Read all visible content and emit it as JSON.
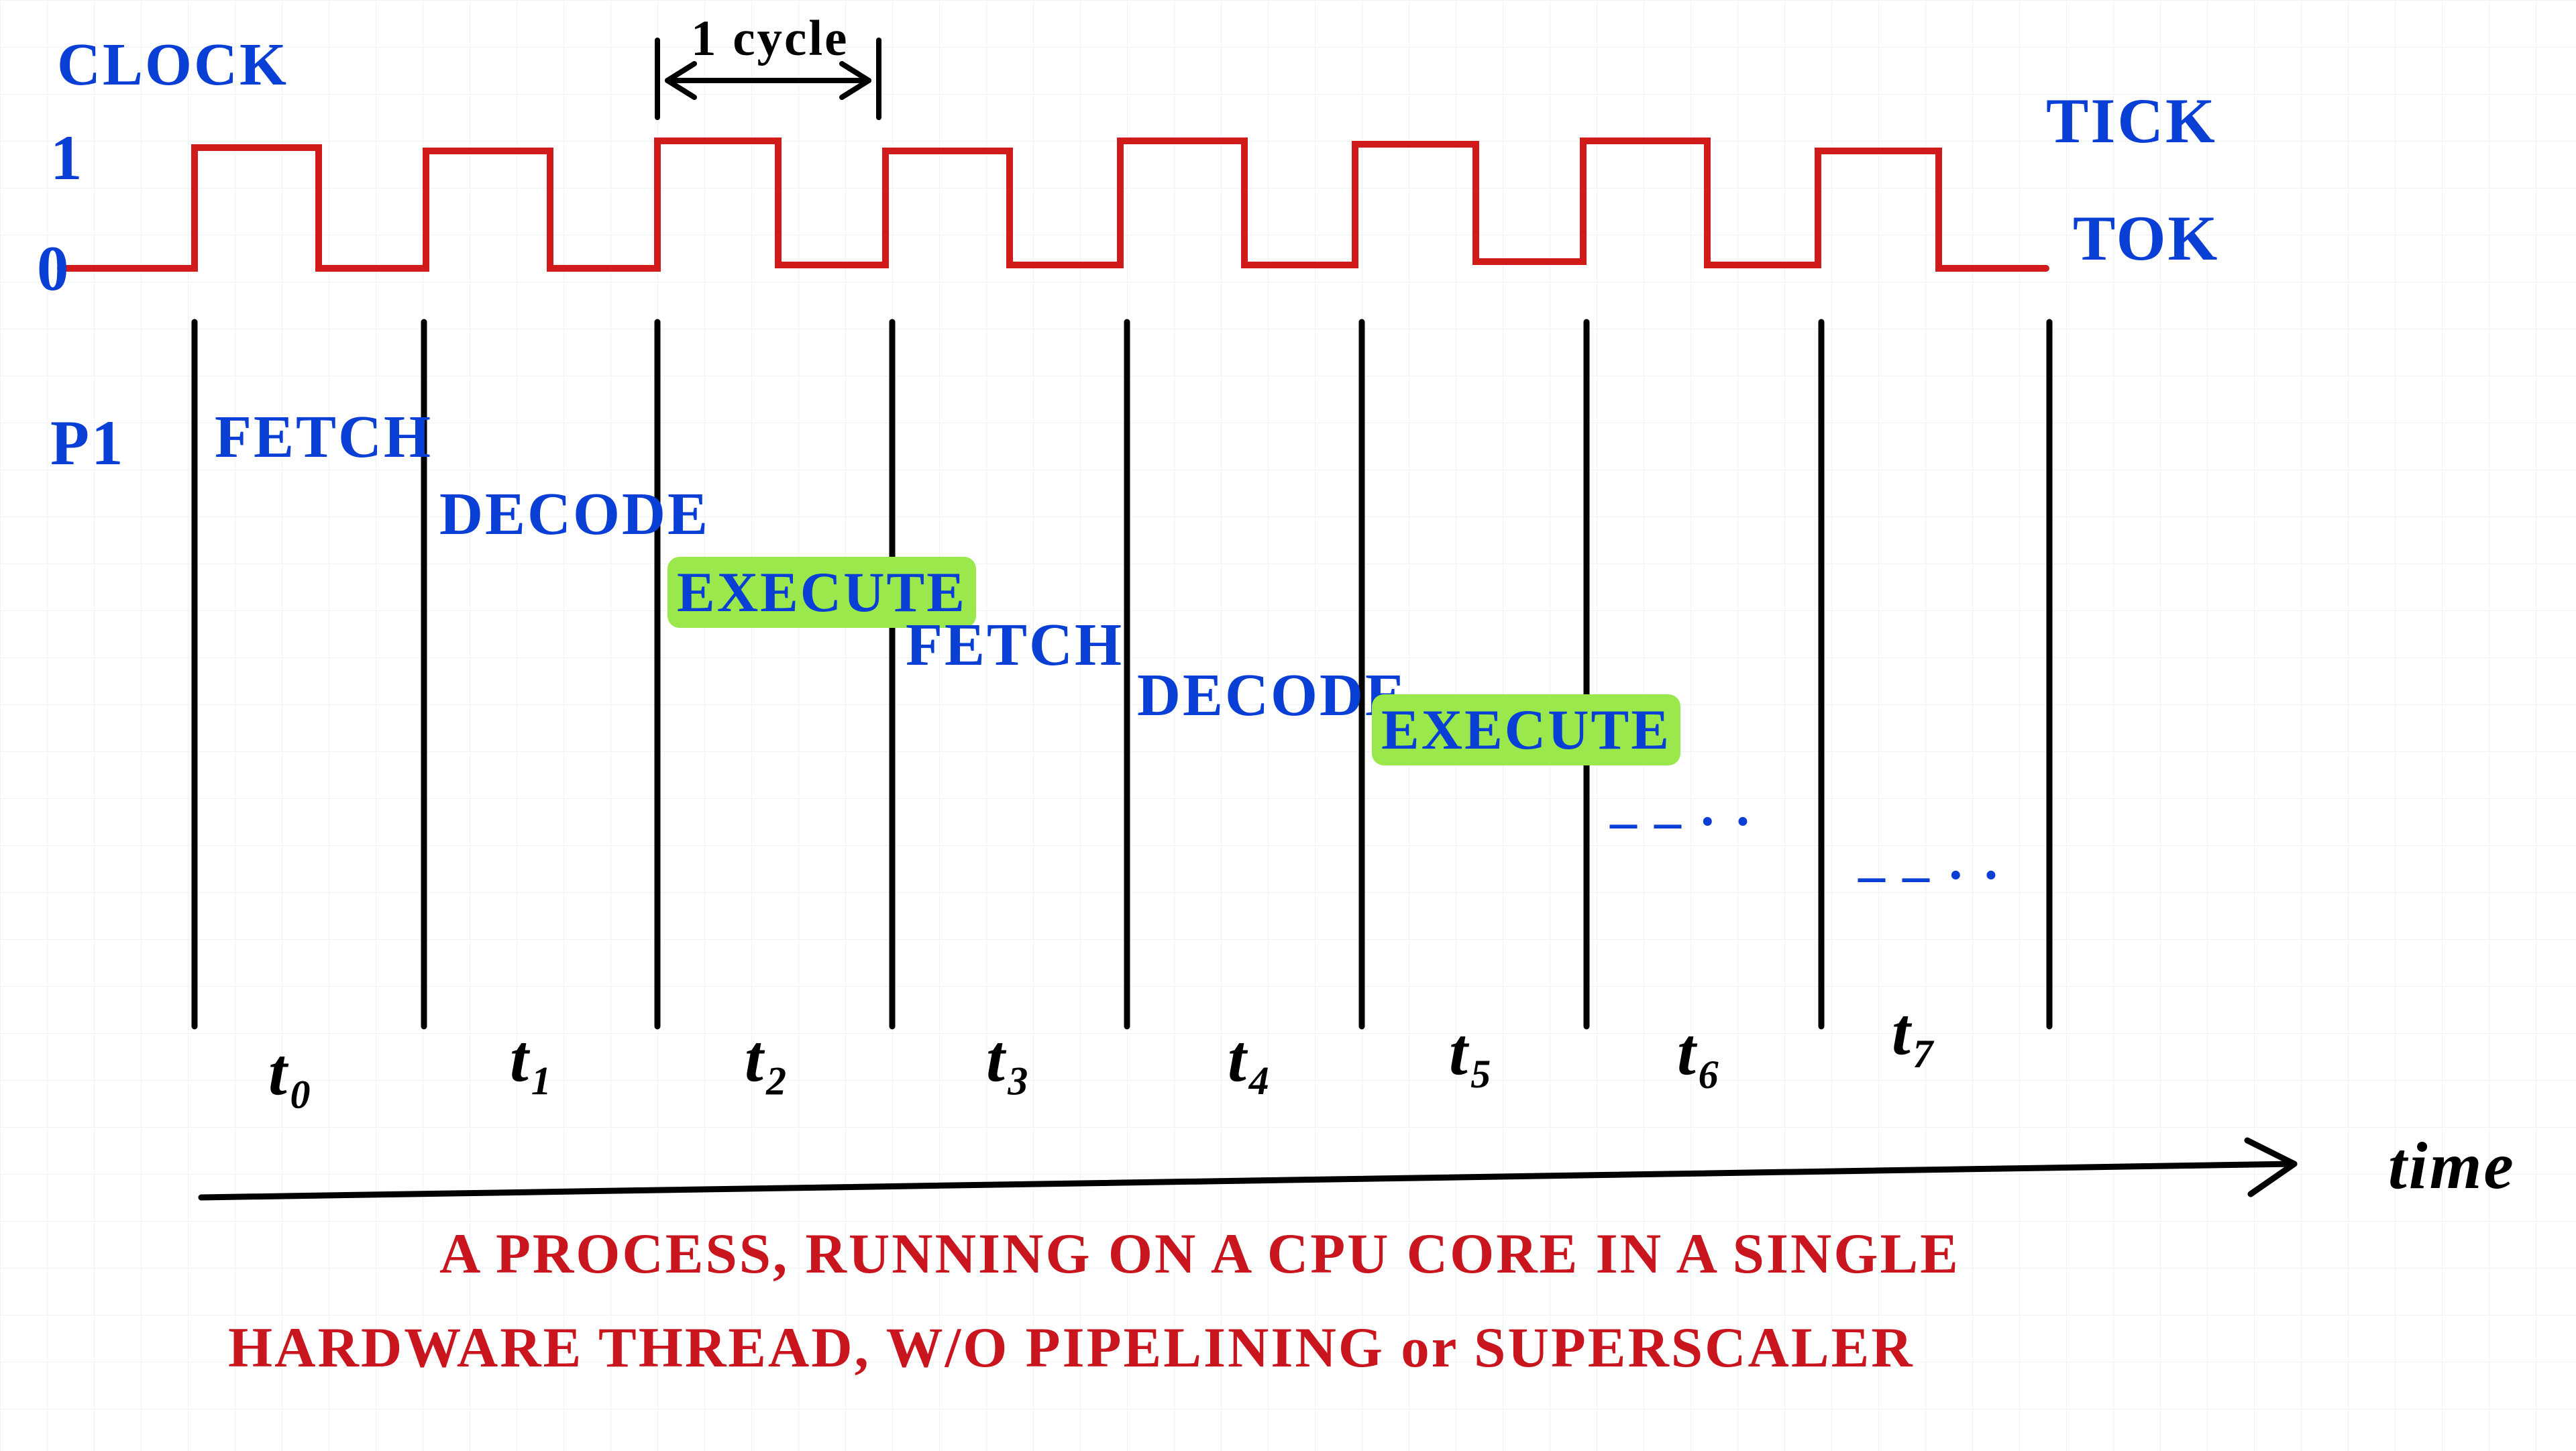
{
  "clock": {
    "label": "CLOCK",
    "one": "1",
    "zero": "0",
    "cycle": "1 cycle",
    "tick": "TICK",
    "tok": "TOK"
  },
  "process": "P1",
  "stages": [
    "FETCH",
    "DECODE",
    "EXECUTE",
    "FETCH",
    "DECODE",
    "EXECUTE"
  ],
  "continuation": [
    "– – · ·",
    "– – · ·"
  ],
  "ticks": [
    "t₀",
    "t₁",
    "t₂",
    "t₃",
    "t₄",
    "t₅",
    "t₆",
    "t₇"
  ],
  "axis": "time",
  "caption1": "A PROCESS, RUNNING ON A CPU CORE IN A SINGLE",
  "caption2": "HARDWARE THREAD, W/O PIPELINING or SUPERSCALER",
  "colors": {
    "clock": "#d11a1a",
    "ink_blue": "#0a3fd6",
    "ink_red": "#c9151e",
    "highlight": "#9be84c"
  }
}
